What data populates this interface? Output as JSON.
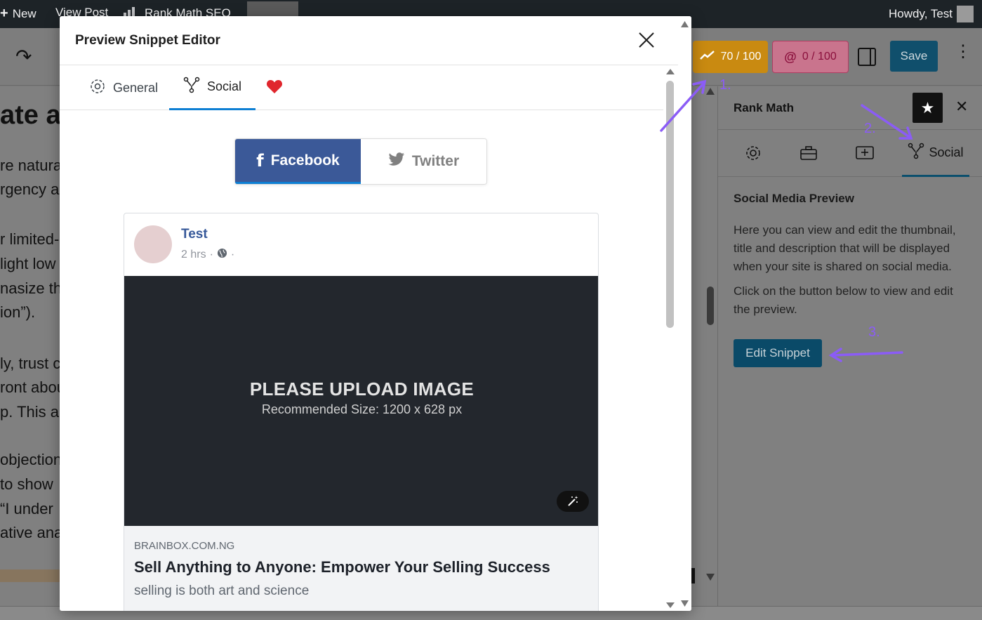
{
  "adminbar": {
    "new_label": "New",
    "view_post_label": "View Post",
    "plugin_label": "Rank Math SEO",
    "howdy_label": "Howdy, Test"
  },
  "toolbar": {
    "seo_score": "70 / 100",
    "content_ai_score": "0 / 100",
    "save_label": "Save"
  },
  "editor": {
    "heading_fragment": "ate a",
    "lines": [
      "re natura",
      "rgency a",
      "r limited-",
      "light low",
      "nasize th",
      "ion”).",
      "ly, trust c",
      "ront abou",
      "p. This a",
      "objection",
      "to show",
      "“I under",
      "ative ana"
    ]
  },
  "sidebar": {
    "title": "Rank Math",
    "active_tab": "Social",
    "section_title": "Social Media Preview",
    "para1": "Here you can view and edit the thumbnail, title and description that will be displayed when your site is shared on social media.",
    "para2": "Click on the button below to view and edit the preview.",
    "edit_button": "Edit Snippet"
  },
  "annotations": {
    "step1": "1.",
    "step2": "2.",
    "step3": "3.",
    "color": "#8b5cf6"
  },
  "modal": {
    "title": "Preview Snippet Editor",
    "tabs": [
      {
        "label": "General",
        "icon": "gear-icon"
      },
      {
        "label": "Social",
        "icon": "share-nodes-icon"
      },
      {
        "label": "",
        "icon": "heart-icon"
      }
    ],
    "active_tab": "Social",
    "networks": {
      "facebook_label": "Facebook",
      "twitter_label": "Twitter",
      "selected": "Facebook"
    },
    "facebook_card": {
      "author": "Test",
      "time": "2 hrs",
      "image_title": "PLEASE UPLOAD IMAGE",
      "image_subtitle": "Recommended Size: 1200 x 628 px",
      "domain": "BRAINBOX.COM.NG",
      "title": "Sell Anything to Anyone: Empower Your Selling Success",
      "description": "selling is both art and science"
    }
  },
  "colors": {
    "facebook_blue": "#3b5998",
    "accent_blue": "#0e7fd3",
    "score_orange": "#c98a11",
    "heart_red": "#e0262d"
  }
}
